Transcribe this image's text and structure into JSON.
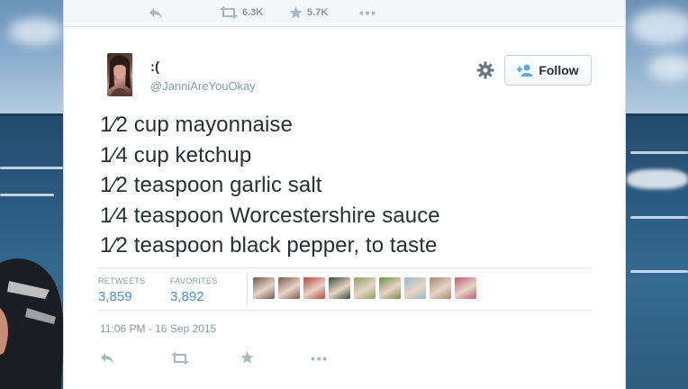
{
  "previous_tweet": {
    "retweet_count": "6.3K",
    "favorite_count": "5.7K"
  },
  "user": {
    "display_name": ":(",
    "handle": "@JanniAreYouOkay"
  },
  "follow_label": "Follow",
  "tweet_lines": [
    "1⁄2 cup mayonnaise",
    "1⁄4 cup ketchup",
    "1⁄2 teaspoon garlic salt",
    "1⁄4 teaspoon Worcestershire sauce",
    "1⁄2 teaspoon black pepper, to taste"
  ],
  "stats": {
    "retweets_label": "RETWEETS",
    "retweets_value": "3,859",
    "favorites_label": "FAVORITES",
    "favorites_value": "3,892"
  },
  "favoriter_avatars": [
    "#6e5a55",
    "#7d5c52",
    "#b9453e",
    "#3f4a3a",
    "#8aa163",
    "#6f8c4e",
    "#9cb9c8",
    "#a38b6f",
    "#b65f77"
  ],
  "timestamp": "11:06 PM - 16 Sep 2015",
  "icons": [
    "reply-icon",
    "retweet-icon",
    "favorite-icon",
    "more-icon",
    "gear-icon",
    "follow-person-icon"
  ],
  "colors": {
    "link_blue": "#4d8ccf",
    "muted": "#8899a6",
    "text": "#292f33"
  }
}
